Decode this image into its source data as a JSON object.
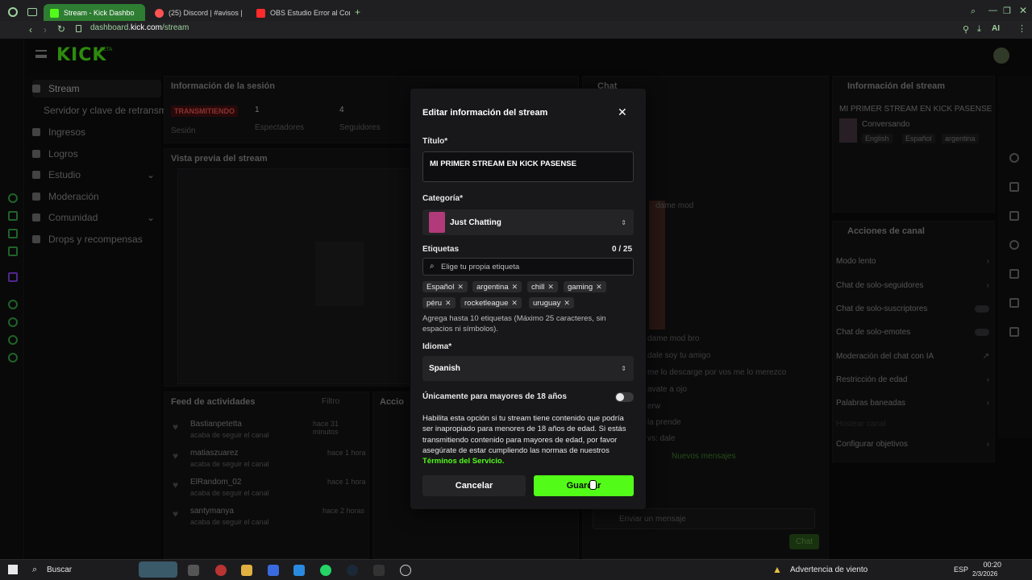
{
  "browser": {
    "tabs": [
      {
        "label": "Stream - Kick Dashbo",
        "active": true
      },
      {
        "label": "(25) Discord | #avisos | El",
        "active": false
      },
      {
        "label": "OBS Estudio Error al Cone",
        "active": false
      }
    ],
    "url_prefix": "dashboard.",
    "url_domain": "kick.com",
    "url_path": "/stream",
    "ai_label": "AI"
  },
  "kick": {
    "logo": "KICK",
    "logo_badge": "BETA",
    "sidebar": {
      "items": [
        {
          "label": "Stream"
        },
        {
          "label": "Servidor y clave de retransm"
        },
        {
          "label": "Ingresos"
        },
        {
          "label": "Logros"
        },
        {
          "label": "Estudio"
        },
        {
          "label": "Moderación"
        },
        {
          "label": "Comunidad"
        },
        {
          "label": "Drops y recompensas"
        }
      ]
    },
    "session": {
      "title": "Información de la sesión",
      "status": "TRANSMITIENDO",
      "session_label": "Sesión",
      "viewers_value": "1",
      "viewers_label": "Espectadores",
      "followers_value": "4",
      "followers_label": "Seguidores"
    },
    "preview": {
      "title": "Vista previa del stream"
    },
    "activity": {
      "title": "Feed de actividades",
      "filter": "Filtro",
      "actions_title": "Accio",
      "items": [
        {
          "user": "Bastianpetetta",
          "time": "hace 31 minutos",
          "desc": "acaba de seguir el canal"
        },
        {
          "user": "matiaszuarez",
          "time": "hace 1 hora",
          "desc": "acaba de seguir el canal"
        },
        {
          "user": "ElRandom_02",
          "time": "hace 1 hora",
          "desc": "acaba de seguir el canal"
        },
        {
          "user": "santymanya",
          "time": "hace 2 horas",
          "desc": "acaba de seguir el canal"
        }
      ]
    },
    "chat": {
      "title": "Chat",
      "messages": [
        {
          "text": "dame mod"
        },
        {
          "text": "dame mod bro"
        },
        {
          "text": "dale soy tu amigo"
        },
        {
          "text": "me lo descarge por vos me lo merezco"
        },
        {
          "text": "avate a ojo"
        },
        {
          "text": "erw"
        },
        {
          "text": "la prende"
        },
        {
          "text": "vs: dale"
        }
      ],
      "new_messages": "Nuevos mensajes",
      "placeholder": "Enviar un mensaje",
      "send": "Chat"
    },
    "stream_info": {
      "title": "Información del stream",
      "stream_title": "MI PRIMER STREAM EN KICK PASENSE",
      "category": "Conversando",
      "tags": [
        "English",
        "Español",
        "argentina"
      ]
    },
    "channel_actions": {
      "title": "Acciones de canal",
      "items": [
        {
          "label": "Modo lento"
        },
        {
          "label": "Chat de solo-seguidores"
        },
        {
          "label": "Chat de solo-suscriptores"
        },
        {
          "label": "Chat de solo-emotes"
        },
        {
          "label": "Moderación del chat con IA"
        },
        {
          "label": "Restricción de edad"
        },
        {
          "label": "Palabras baneadas"
        },
        {
          "label": "Hostear canal"
        },
        {
          "label": "Configurar objetivos"
        }
      ]
    }
  },
  "modal": {
    "title": "Editar información del stream",
    "title_label": "Título*",
    "title_value": "MI PRIMER STREAM EN KICK PASENSE",
    "category_label": "Categoría*",
    "category_value": "Just Chatting",
    "tags_label": "Etiquetas",
    "tags_count": "0 / 25",
    "tags_placeholder": "Elige tu propia etiqueta",
    "tags": [
      "Español",
      "argentina",
      "chill",
      "gaming",
      "péru",
      "rocketleague",
      "uruguay"
    ],
    "tags_help": "Agrega hasta 10 etiquetas (Máximo 25 caracteres, sin espacios ni símbolos).",
    "language_label": "Idioma*",
    "language_value": "Spanish",
    "mature_label": "Únicamente para mayores de 18 años",
    "mature_enabled": false,
    "mature_help": "Habilita esta opción si tu stream tiene contenido que podría ser inapropiado para menores de 18 años de edad. Si estás transmitiendo contenido para mayores de edad, por favor asegúrate de estar cumpliendo las normas de nuestros",
    "terms_link": "Términos del Servicio.",
    "cancel": "Cancelar",
    "save": "Guardar"
  },
  "taskbar": {
    "search": "Buscar",
    "weather": "Advertencia de viento",
    "lang": "ESP",
    "time": "00:20",
    "date": "2/3/2026"
  },
  "colors": {
    "accent": "#53fc18",
    "live": "#e02424",
    "tab_active": "#2e7d32"
  }
}
